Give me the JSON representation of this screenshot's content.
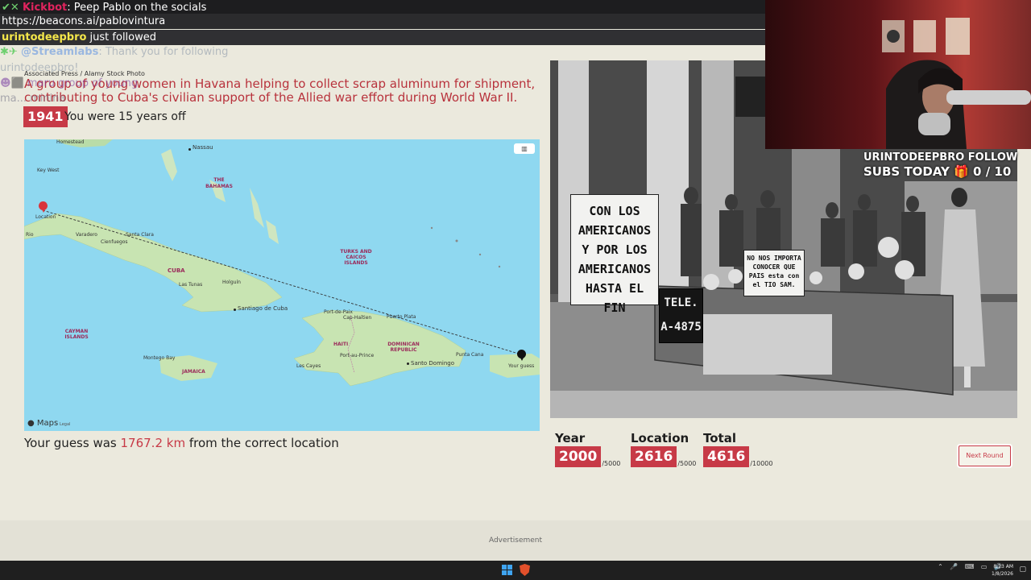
{
  "chat": {
    "bot_name": "Kickbot",
    "bot_message": ": Peep Pablo on the socials",
    "link": "https://beacons.ai/pablovintura",
    "follower_name": "urintodeepbro",
    "follow_text": " just followed",
    "streamlabs_name": "@Streamlabs",
    "streamlabs_text": ": Thank you for following",
    "faded_user": "urintodeepbro!",
    "faded_partial": "maru group of young",
    "faded_tail": "ma... minina"
  },
  "clue": {
    "credit": "Associated Press / Alamy Stock Photo",
    "caption": "A group of young women in Havana helping to collect scrap aluminum for shipment, contributing to Cuba's civilian support of the Allied war effort during World War II.",
    "year": "1941",
    "year_off": "You were 15 years off"
  },
  "map": {
    "layers_icon": "map-layers-icon",
    "logo": " Maps",
    "legal": "Legal",
    "labels": {
      "homestead": "Homestead",
      "nassau": "Nassau",
      "key_west": "Key West",
      "bahamas": "THE BAHAMAS",
      "varadero": "Varadero",
      "havana": "Havana",
      "rio": "Rio",
      "santa_clara": "Santa Clara",
      "cienfuegos": "Cienfuegos",
      "cuba": "CUBA",
      "las_tunas": "Las Tunas",
      "holguin": "Holguín",
      "santiago": "Santiago de Cuba",
      "turks": "TURKS AND CAICOS ISLANDS",
      "cayman": "CAYMAN ISLANDS",
      "montego": "Montego Bay",
      "jamaica": "JAMAICA",
      "port_de_paix": "Port-de-Paix",
      "cap_haitien": "Cap-Haïtien",
      "puerto_plata": "Puerto Plata",
      "haiti": "HAITI",
      "dominican": "DOMINICAN REPUBLIC",
      "port_au_prince": "Port-au-Prince",
      "les_cayes": "Les Cayes",
      "santo_domingo": "Santo Domingo",
      "punta_cana": "Punta Cana",
      "your_guess": "Your guess",
      "location": "Location"
    }
  },
  "result": {
    "prefix": "Your guess was ",
    "distance": "1767.2 km",
    "suffix": " from the correct location"
  },
  "photo": {
    "sign_1": "CON LOS AMERICANOS Y POR LOS AMERICANOS HASTA EL FIN",
    "sign_2": "NO NOS IMPORTA CONOCER QUE PAIS esta con el TIO SAM.",
    "sign_3": "TELE. A-4875"
  },
  "scores": {
    "year_label": "Year",
    "year_value": "2000",
    "year_max": "/5000",
    "location_label": "Location",
    "location_value": "2616",
    "location_max": "/5000",
    "total_label": "Total",
    "total_value": "4616",
    "total_max": "/10000"
  },
  "next_round": "Next Round",
  "stream": {
    "follow_line": "URINTODEEPBRO FOLLOW",
    "subs_line": "SUBS TODAY 🎁 0 / 10"
  },
  "ad": "Advertisement",
  "taskbar": {
    "time": "8:23 AM",
    "date": "1/8/2026"
  },
  "colors": {
    "accent": "#c73a47",
    "map_water": "#8fd8f0",
    "background": "#ebe9dd"
  }
}
